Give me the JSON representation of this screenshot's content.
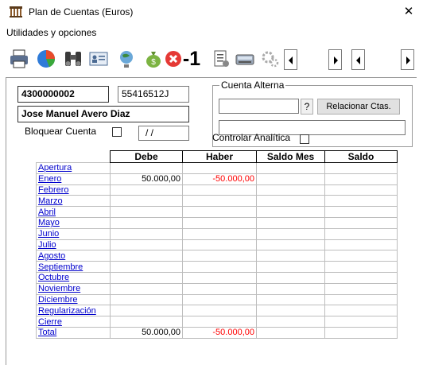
{
  "window": {
    "title": "Plan de Cuentas (Euros)",
    "close_glyph": "✕"
  },
  "menu": {
    "utilities_label": "Utilidades y opciones"
  },
  "toolbar": {
    "icons": [
      "print-icon",
      "pie-chart-icon",
      "binoculars-icon",
      "id-card-icon",
      "globe-icon",
      "money-bag-icon",
      "cancel-icon",
      "minus-one-icon",
      "document-icon",
      "scanner-icon",
      "gears-icon"
    ],
    "minus_one_label": "-1"
  },
  "account": {
    "code": "4300000002",
    "tax_id": "55416512J",
    "name": "Jose Manuel Avero Diaz",
    "lock_label": "Bloquear Cuenta",
    "lock_date": " / /"
  },
  "alt_account": {
    "group_title": "Cuenta Alterna",
    "code_value": "",
    "question_label": "?",
    "relate_label": "Relacionar Ctas.",
    "description_value": ""
  },
  "analytics": {
    "label": "Controlar Analítica"
  },
  "table": {
    "headers": [
      "Debe",
      "Haber",
      "Saldo Mes",
      "Saldo"
    ],
    "rows": [
      {
        "label": "Apertura",
        "debe": "",
        "haber": "",
        "saldo_mes": "",
        "saldo": ""
      },
      {
        "label": "Enero",
        "debe": "50.000,00",
        "haber": "-50.000,00",
        "saldo_mes": "",
        "saldo": ""
      },
      {
        "label": "Febrero",
        "debe": "",
        "haber": "",
        "saldo_mes": "",
        "saldo": ""
      },
      {
        "label": "Marzo",
        "debe": "",
        "haber": "",
        "saldo_mes": "",
        "saldo": ""
      },
      {
        "label": "Abril",
        "debe": "",
        "haber": "",
        "saldo_mes": "",
        "saldo": ""
      },
      {
        "label": "Mayo",
        "debe": "",
        "haber": "",
        "saldo_mes": "",
        "saldo": ""
      },
      {
        "label": "Junio",
        "debe": "",
        "haber": "",
        "saldo_mes": "",
        "saldo": ""
      },
      {
        "label": "Julio",
        "debe": "",
        "haber": "",
        "saldo_mes": "",
        "saldo": ""
      },
      {
        "label": "Agosto",
        "debe": "",
        "haber": "",
        "saldo_mes": "",
        "saldo": ""
      },
      {
        "label": "Septiembre",
        "debe": "",
        "haber": "",
        "saldo_mes": "",
        "saldo": ""
      },
      {
        "label": "Octubre",
        "debe": "",
        "haber": "",
        "saldo_mes": "",
        "saldo": ""
      },
      {
        "label": "Noviembre",
        "debe": "",
        "haber": "",
        "saldo_mes": "",
        "saldo": ""
      },
      {
        "label": "Diciembre",
        "debe": "",
        "haber": "",
        "saldo_mes": "",
        "saldo": ""
      },
      {
        "label": "Regularización",
        "debe": "",
        "haber": "",
        "saldo_mes": "",
        "saldo": ""
      },
      {
        "label": "Cierre",
        "debe": "",
        "haber": "",
        "saldo_mes": "",
        "saldo": ""
      },
      {
        "label": "Total",
        "debe": "50.000,00",
        "haber": "-50.000,00",
        "saldo_mes": "",
        "saldo": ""
      }
    ]
  },
  "colors": {
    "link": "#0000cc",
    "negative": "#ff0000",
    "grid_line": "#bdbdbd"
  }
}
